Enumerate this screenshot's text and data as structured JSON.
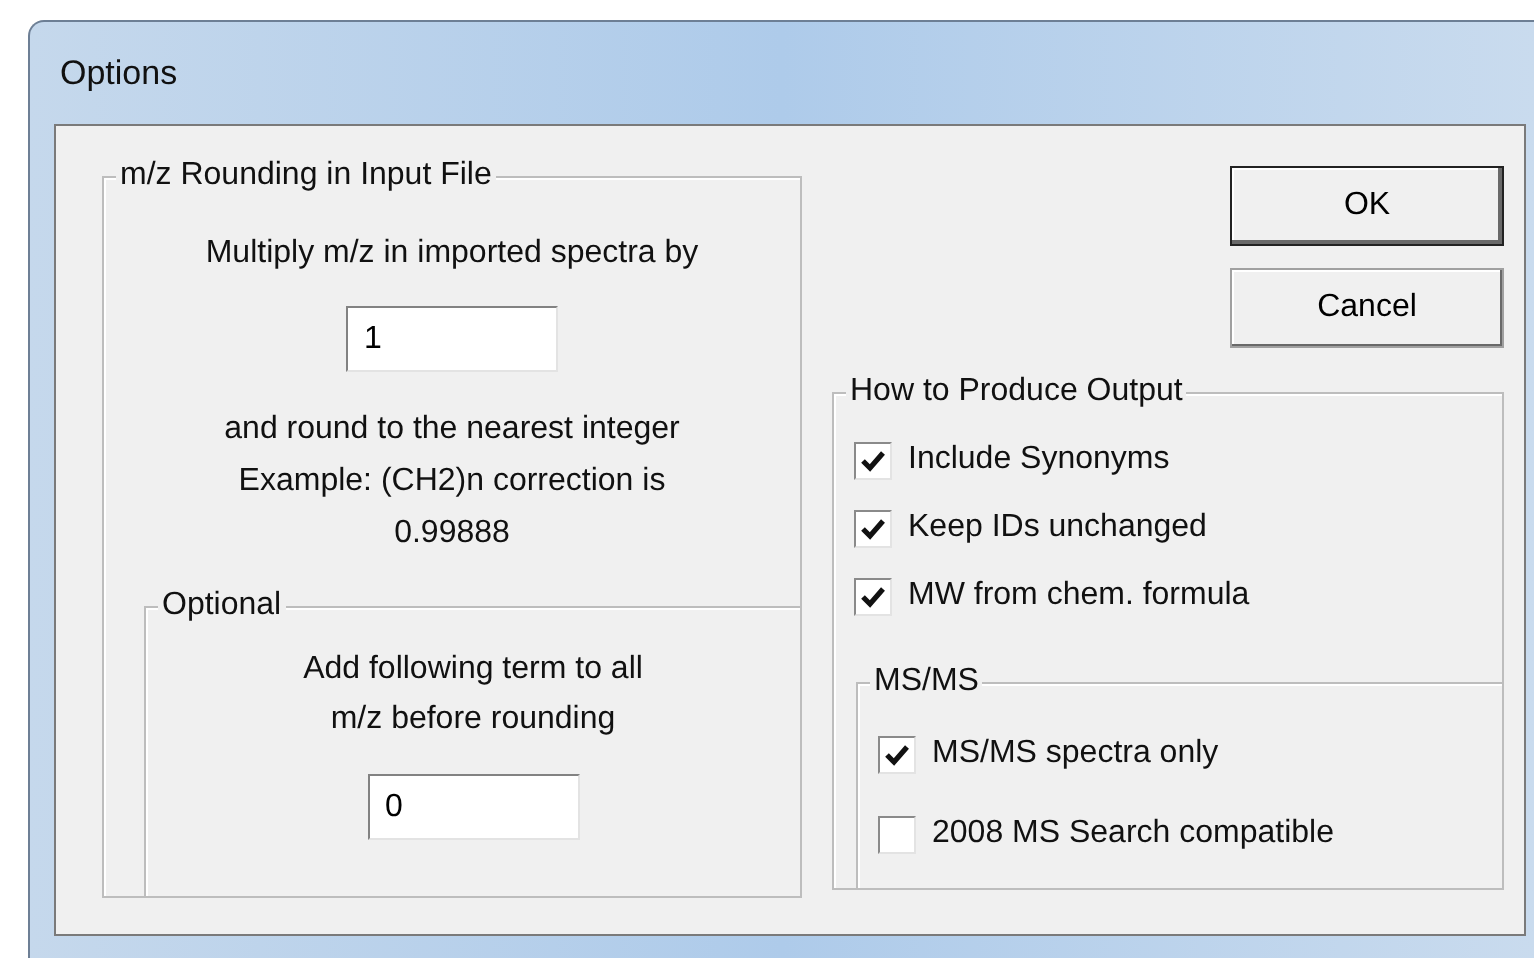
{
  "window": {
    "title": "Options"
  },
  "rounding_group": {
    "title": "m/z Rounding in Input File",
    "instruction": "Multiply m/z in imported spectra by",
    "multiplier_field": {
      "value": "1"
    },
    "note_lines": [
      "and round to the nearest integer",
      "Example: (CH2)n correction is",
      "0.99888"
    ],
    "optional_group": {
      "title": "Optional",
      "instruction_lines": [
        "Add following term to all",
        "m/z before rounding"
      ],
      "offset_field": {
        "value": "0"
      }
    }
  },
  "buttons": [
    {
      "label": "OK",
      "default": true
    },
    {
      "label": "Cancel",
      "default": false
    }
  ],
  "output_group": {
    "title": "How to Produce Output",
    "options": [
      {
        "label": "Include Synonyms",
        "checked": true
      },
      {
        "label": "Keep IDs unchanged",
        "checked": true
      },
      {
        "label": "MW from chem. formula",
        "checked": true
      }
    ],
    "msms_group": {
      "title": "MS/MS",
      "options": [
        {
          "label": "MS/MS spectra only",
          "checked": true
        },
        {
          "label": "2008 MS Search compatible",
          "checked": false
        }
      ]
    }
  }
}
